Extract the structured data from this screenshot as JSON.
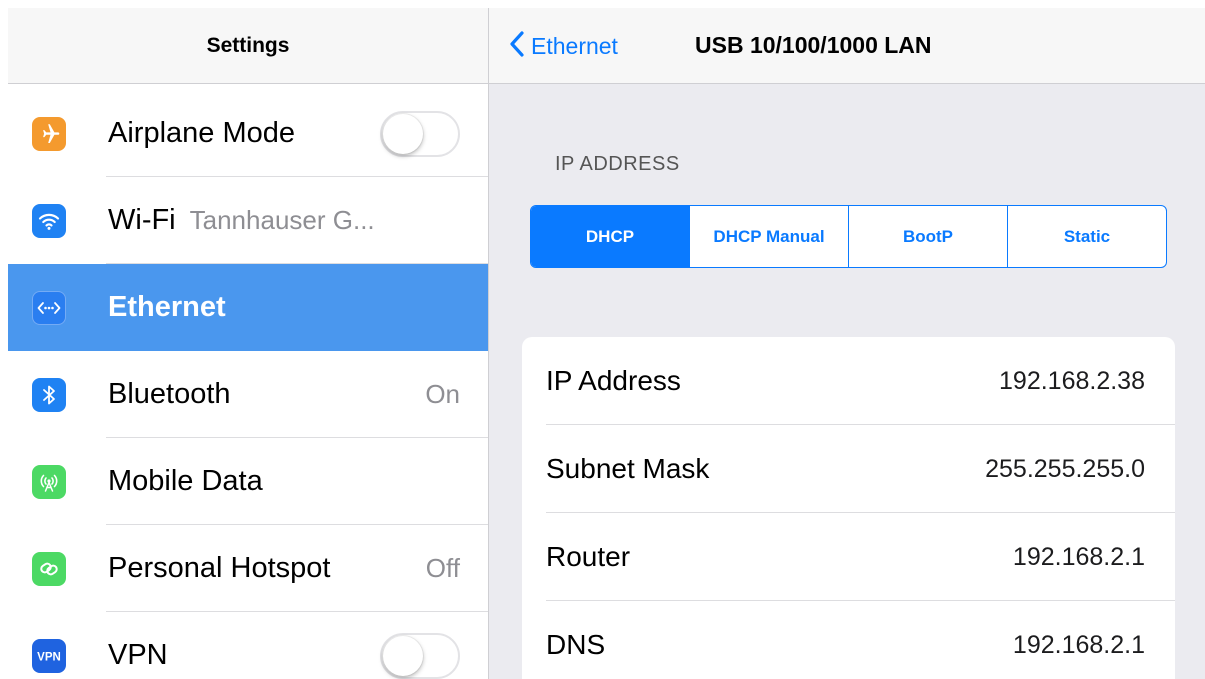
{
  "sidebar": {
    "title": "Settings",
    "items": [
      {
        "label": "Airplane Mode",
        "icon": "airplane-icon",
        "icon_color": "#f49a2e",
        "control": "toggle",
        "toggle_on": false
      },
      {
        "label": "Wi-Fi",
        "value": "Tannhauser G...",
        "icon": "wifi-icon",
        "icon_color": "#1f82f3"
      },
      {
        "label": "Ethernet",
        "icon": "ethernet-icon",
        "icon_color": "#2a7ef0",
        "selected": true
      },
      {
        "label": "Bluetooth",
        "value": "On",
        "icon": "bluetooth-icon",
        "icon_color": "#1f82f3"
      },
      {
        "label": "Mobile Data",
        "icon": "antenna-icon",
        "icon_color": "#4cd964"
      },
      {
        "label": "Personal Hotspot",
        "value": "Off",
        "icon": "hotspot-icon",
        "icon_color": "#4cd964"
      },
      {
        "label": "VPN",
        "icon": "vpn-icon",
        "icon_color": "#1f63e0",
        "control": "toggle",
        "toggle_on": false
      }
    ]
  },
  "detail": {
    "back_label": "Ethernet",
    "title": "USB 10/100/1000 LAN",
    "section_header": "IP ADDRESS",
    "segments": [
      {
        "label": "DHCP",
        "active": true
      },
      {
        "label": "DHCP Manual",
        "active": false
      },
      {
        "label": "BootP",
        "active": false
      },
      {
        "label": "Static",
        "active": false
      }
    ],
    "rows": [
      {
        "label": "IP Address",
        "value": "192.168.2.38"
      },
      {
        "label": "Subnet Mask",
        "value": "255.255.255.0"
      },
      {
        "label": "Router",
        "value": "192.168.2.1"
      },
      {
        "label": "DNS",
        "value": "192.168.2.1"
      }
    ]
  },
  "colors": {
    "accent": "#0a7aff",
    "selected_row": "#4a97ee",
    "detail_background": "#ebebf0"
  }
}
